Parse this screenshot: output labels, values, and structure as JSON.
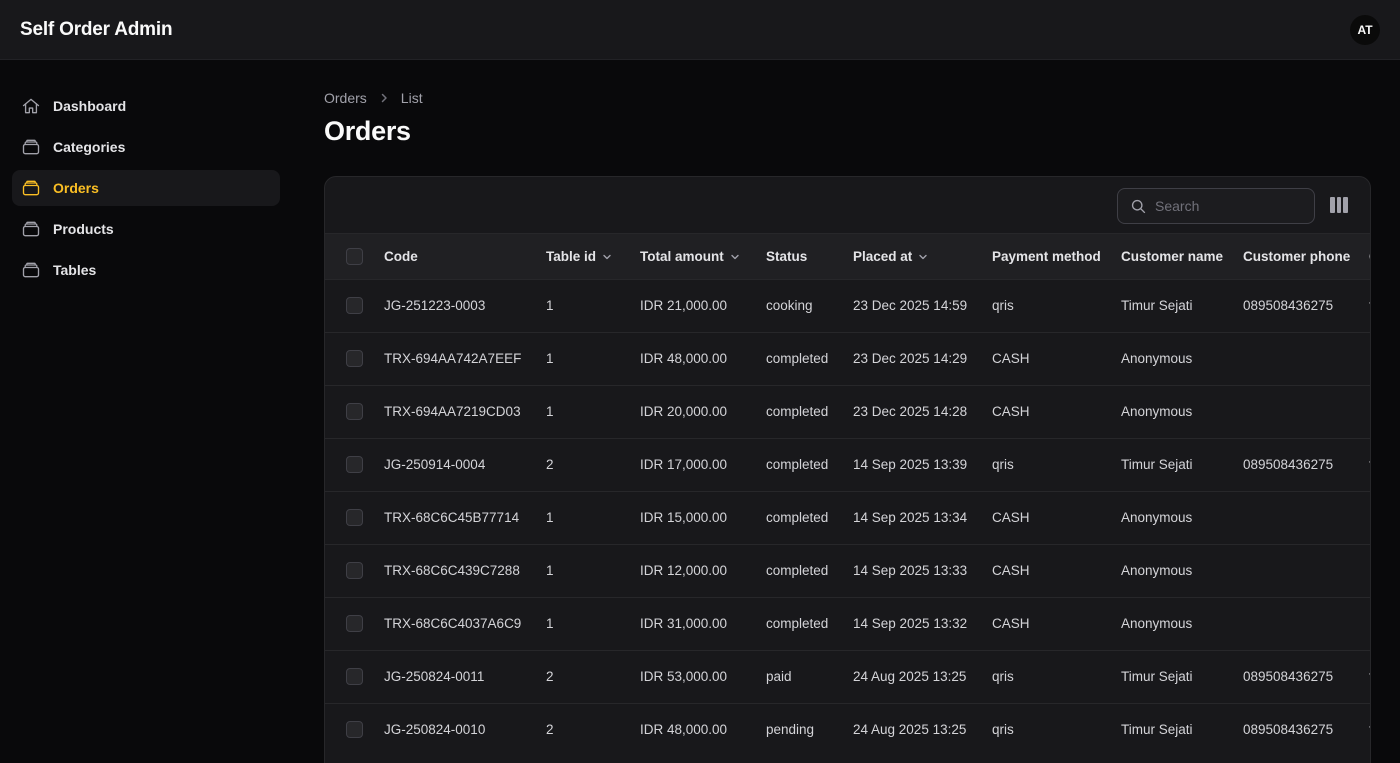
{
  "app": {
    "title": "Self Order Admin",
    "avatar_initials": "AT"
  },
  "sidebar": {
    "items": [
      {
        "label": "Dashboard",
        "icon": "home-icon",
        "active": false
      },
      {
        "label": "Categories",
        "icon": "stack-icon",
        "active": false
      },
      {
        "label": "Orders",
        "icon": "stack-icon",
        "active": true
      },
      {
        "label": "Products",
        "icon": "stack-icon",
        "active": false
      },
      {
        "label": "Tables",
        "icon": "stack-icon",
        "active": false
      }
    ]
  },
  "breadcrumb": {
    "items": [
      "Orders",
      "List"
    ]
  },
  "page": {
    "title": "Orders"
  },
  "search": {
    "placeholder": "Search"
  },
  "table": {
    "columns": [
      {
        "label": "Code",
        "sortable": false
      },
      {
        "label": "Table id",
        "sortable": true
      },
      {
        "label": "Total amount",
        "sortable": true
      },
      {
        "label": "Status",
        "sortable": false
      },
      {
        "label": "Placed at",
        "sortable": true
      },
      {
        "label": "Payment method",
        "sortable": false
      },
      {
        "label": "Customer name",
        "sortable": false
      },
      {
        "label": "Customer phone",
        "sortable": false
      },
      {
        "label": "C",
        "sortable": false
      }
    ],
    "rows": [
      {
        "code": "JG-251223-0003",
        "table_id": "1",
        "total": "IDR 21,000.00",
        "status": "cooking",
        "placed_at": "23 Dec 2025 14:59",
        "payment": "qris",
        "customer": "Timur Sejati",
        "phone": "089508436275",
        "extra": "t"
      },
      {
        "code": "TRX-694AA742A7EEF",
        "table_id": "1",
        "total": "IDR 48,000.00",
        "status": "completed",
        "placed_at": "23 Dec 2025 14:29",
        "payment": "CASH",
        "customer": "Anonymous",
        "phone": "",
        "extra": ""
      },
      {
        "code": "TRX-694AA7219CD03",
        "table_id": "1",
        "total": "IDR 20,000.00",
        "status": "completed",
        "placed_at": "23 Dec 2025 14:28",
        "payment": "CASH",
        "customer": "Anonymous",
        "phone": "",
        "extra": ""
      },
      {
        "code": "JG-250914-0004",
        "table_id": "2",
        "total": "IDR 17,000.00",
        "status": "completed",
        "placed_at": "14 Sep 2025 13:39",
        "payment": "qris",
        "customer": "Timur Sejati",
        "phone": "089508436275",
        "extra": "t"
      },
      {
        "code": "TRX-68C6C45B77714",
        "table_id": "1",
        "total": "IDR 15,000.00",
        "status": "completed",
        "placed_at": "14 Sep 2025 13:34",
        "payment": "CASH",
        "customer": "Anonymous",
        "phone": "",
        "extra": ""
      },
      {
        "code": "TRX-68C6C439C7288",
        "table_id": "1",
        "total": "IDR 12,000.00",
        "status": "completed",
        "placed_at": "14 Sep 2025 13:33",
        "payment": "CASH",
        "customer": "Anonymous",
        "phone": "",
        "extra": ""
      },
      {
        "code": "TRX-68C6C4037A6C9",
        "table_id": "1",
        "total": "IDR 31,000.00",
        "status": "completed",
        "placed_at": "14 Sep 2025 13:32",
        "payment": "CASH",
        "customer": "Anonymous",
        "phone": "",
        "extra": ""
      },
      {
        "code": "JG-250824-0011",
        "table_id": "2",
        "total": "IDR 53,000.00",
        "status": "paid",
        "placed_at": "24 Aug 2025 13:25",
        "payment": "qris",
        "customer": "Timur Sejati",
        "phone": "089508436275",
        "extra": "t"
      },
      {
        "code": "JG-250824-0010",
        "table_id": "2",
        "total": "IDR 48,000.00",
        "status": "pending",
        "placed_at": "24 Aug 2025 13:25",
        "payment": "qris",
        "customer": "Timur Sejati",
        "phone": "089508436275",
        "extra": "t"
      }
    ]
  },
  "colors": {
    "accent": "#fbbf24",
    "background": "#09090b",
    "surface": "#18181b"
  }
}
